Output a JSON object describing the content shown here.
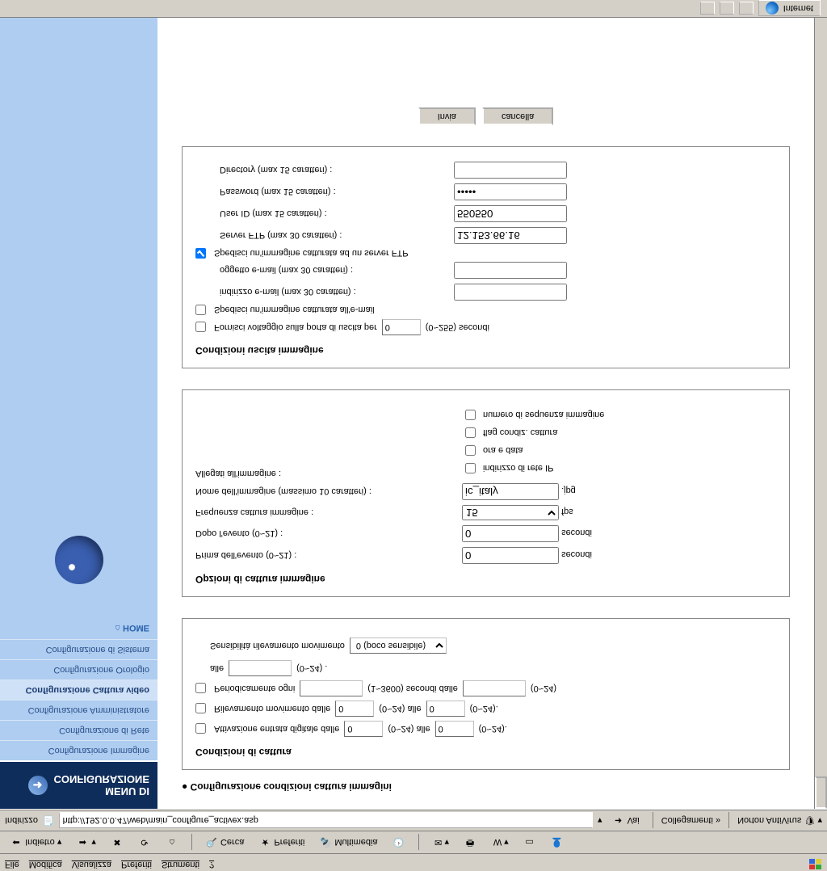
{
  "menubar": [
    "File",
    "Modifica",
    "Visualizza",
    "Preferiti",
    "Strumenti",
    "?"
  ],
  "toolbar": {
    "back": "Indietro",
    "search": "Cerca",
    "favorites": "Preferiti",
    "media": "Multimedia"
  },
  "addrbar": {
    "label": "Indirizzo",
    "url": "http://192.0.0.47/web/main_configure_activex.asp",
    "go": "Vai",
    "links": "Collegamenti",
    "norton": "Norton AntiVirus"
  },
  "sidebar": {
    "header1": "MENU DI",
    "header2": "CONFIGURAZIONE",
    "items": [
      "Configurazione Immagine",
      "Configurazione di Rete",
      "Configurazione Amministratore",
      "Configurazione Cattura video",
      "Configurazione Orologio",
      "Configurazione di Sistema"
    ],
    "home": "HOME"
  },
  "page": {
    "title": "Configurazione condizioni cattura immagini"
  },
  "cond": {
    "title": "Condizioni di cattura",
    "row1a": "Attivazione entrata digitale dalle",
    "row1b": "(0~24) alle",
    "row1c": "(0~24).",
    "v1a": "0",
    "v1b": "0",
    "row2a": "Rilevamento movimento dalle",
    "row2b": "(0~24) alle",
    "row2c": "(0~24).",
    "v2a": "0",
    "v2b": "0",
    "row3a": "Periodicamente ogni",
    "row3b": "(1~3600) secondi dalle",
    "row3c": "(0~24)",
    "v3a": "",
    "v3b": "",
    "row4a": "alle",
    "row4b": "(0~24) .",
    "v4a": "",
    "sensLabel": "Sensibilità rilevamento movimento",
    "sensVal": "0 (poco sensibile)"
  },
  "opts": {
    "title": "Opzioni di cattura immagine",
    "beforeLabel": "Prima dell'evento (0~21) :",
    "beforeVal": "0",
    "sec": "secondi",
    "afterLabel": "Dopo l'evento (0~21) :",
    "afterVal": "0",
    "freqLabel": "Frequenza cattura immagine :",
    "freqVal": "15",
    "fps": "fps",
    "nameLabel": "Nome dell'immagine (massimo 10 caratteri) :",
    "nameVal": "ic_italy",
    "jpg": ".jpg",
    "attachLabel": "Allegati all'immagine :",
    "attach": [
      "indirizzo di rete IP",
      "ora e data",
      "flag condiz. cattura",
      "numero di sequenza immagine"
    ]
  },
  "out": {
    "title": "Condizioni uscita immagine",
    "voltRow": "Fornisci voltaggio sulla porta di uscita per",
    "voltVal": "0",
    "voltAfter": "(0~255) secondi",
    "sendMail": "Spedisci un'immagine catturata all'e-mail",
    "mailAddrLabel": "indirizzo e-mail (max 30 caratteri) :",
    "mailAddrVal": "",
    "mailSubjLabel": "oggetto e-mail (max 30 caratteri) :",
    "mailSubjVal": "",
    "sendFtp": "Spedisci un'immagine catturata ad un server FTP",
    "ftpServerLabel": "Server FTP (max 30 caratteri) :",
    "ftpServerVal": "12.153.66.16",
    "ftpUserLabel": "User ID (max 15 caratteri) :",
    "ftpUserVal": "550550",
    "ftpPassLabel": "Password (max 15 caratteri) :",
    "ftpPassVal": "*****",
    "ftpDirLabel": "Directory (max 15 caratteri) :",
    "ftpDirVal": ""
  },
  "buttons": {
    "submit": "Invia",
    "cancel": "cancella"
  },
  "status": {
    "zone": "Internet"
  }
}
